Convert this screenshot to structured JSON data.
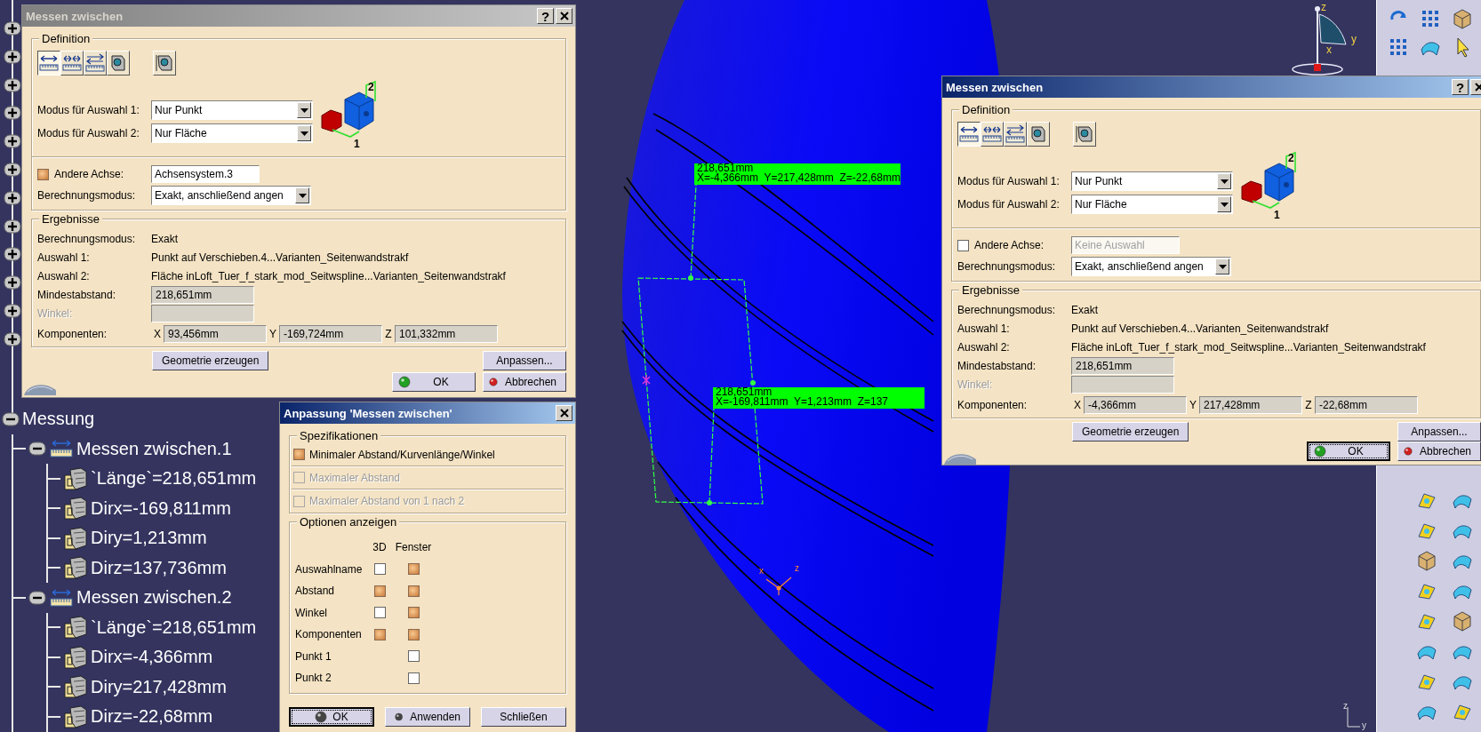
{
  "tree": {
    "hidden_nodes": [
      {
        "expanded": false
      },
      {
        "expanded": false
      },
      {
        "expanded": false
      },
      {
        "expanded": false
      },
      {
        "expanded": false
      },
      {
        "expanded": false
      },
      {
        "expanded": false
      },
      {
        "expanded": false
      },
      {
        "expanded": false
      },
      {
        "expanded": false
      },
      {
        "expanded": false
      },
      {
        "expanded": false
      }
    ],
    "root": {
      "label": "Messung",
      "expanded": true,
      "children": [
        {
          "label": "Messen zwischen.1",
          "expanded": true,
          "children": [
            {
              "label": "`Länge`=218,651mm"
            },
            {
              "label": "Dirx=-169,811mm"
            },
            {
              "label": "Diry=1,213mm"
            },
            {
              "label": "Dirz=137,736mm"
            }
          ]
        },
        {
          "label": "Messen zwischen.2",
          "expanded": true,
          "children": [
            {
              "label": "`Länge`=218,651mm"
            },
            {
              "label": "Dirx=-4,366mm"
            },
            {
              "label": "Diry=217,428mm"
            },
            {
              "label": "Dirz=-22,68mm"
            }
          ]
        }
      ]
    }
  },
  "dialogs": [
    {
      "title": "Messen zwischen",
      "active": false,
      "help_button": "?",
      "definition": {
        "legend": "Definition",
        "tools": [
          {
            "kind": "point-distance",
            "selected": true
          },
          {
            "kind": "chain",
            "selected": false
          },
          {
            "kind": "fan",
            "selected": false
          },
          {
            "kind": "item",
            "selected": false
          },
          {
            "kind": "thickness",
            "selected": false
          }
        ],
        "modes": [
          {
            "label": "Modus für Auswahl 1:",
            "value": "Nur Punkt"
          },
          {
            "label": "Modus für Auswahl 2:",
            "value": "Nur Fläche"
          }
        ],
        "preview_labels": [
          "2",
          "1"
        ],
        "other_axis": {
          "label": "Andere Achse:",
          "checked": true,
          "disabled": false,
          "value": "Achsensystem.3"
        },
        "calc_mode": {
          "label": "Berechnungsmodus:",
          "value": "Exakt, anschließend angen"
        }
      },
      "results": {
        "legend": "Ergebnisse",
        "rows": [
          {
            "label": "Berechnungsmodus:",
            "value": "Exakt"
          },
          {
            "label": "Auswahl 1:",
            "value": "Punkt auf Verschieben.4...Varianten_Seitenwandstrakf"
          },
          {
            "label": "Auswahl 2:",
            "value": "Fläche inLoft_Tuer_f_stark_mod_Seitwspline...Varianten_Seitenwandstrakf"
          }
        ],
        "min_distance": {
          "label": "Mindestabstand:",
          "value": "218,651mm"
        },
        "angle": {
          "label": "Winkel:",
          "disabled": true
        },
        "components": {
          "label": "Komponenten:",
          "items": [
            {
              "axis": "X",
              "value": "93,456mm"
            },
            {
              "axis": "Y",
              "value": "-169,724mm"
            },
            {
              "axis": "Z",
              "value": "101,332mm"
            }
          ]
        }
      },
      "actions": [
        {
          "kind": "geometry",
          "label": "Geometrie erzeugen"
        },
        {
          "kind": "customize",
          "label": "Anpassen..."
        }
      ],
      "footer": [
        {
          "kind": "ok",
          "label": "OK",
          "color": "#22a022",
          "focused": false
        },
        {
          "kind": "cancel",
          "label": "Abbrechen",
          "color": "#d02020",
          "focused": false
        }
      ]
    },
    {
      "title": "Messen zwischen",
      "active": true,
      "help_button": "?",
      "definition": {
        "legend": "Definition",
        "tools": [
          {
            "kind": "point-distance",
            "selected": true
          },
          {
            "kind": "chain",
            "selected": false
          },
          {
            "kind": "fan",
            "selected": false
          },
          {
            "kind": "item",
            "selected": false
          },
          {
            "kind": "thickness",
            "selected": false
          }
        ],
        "modes": [
          {
            "label": "Modus für Auswahl 1:",
            "value": "Nur Punkt"
          },
          {
            "label": "Modus für Auswahl 2:",
            "value": "Nur Fläche"
          }
        ],
        "preview_labels": [
          "2",
          "1"
        ],
        "other_axis": {
          "label": "Andere Achse:",
          "checked": false,
          "disabled": true,
          "placeholder": "Keine Auswahl"
        },
        "calc_mode": {
          "label": "Berechnungsmodus:",
          "value": "Exakt, anschließend angen"
        }
      },
      "results": {
        "legend": "Ergebnisse",
        "rows": [
          {
            "label": "Berechnungsmodus:",
            "value": "Exakt"
          },
          {
            "label": "Auswahl 1:",
            "value": "Punkt auf Verschieben.4...Varianten_Seitenwandstrakf"
          },
          {
            "label": "Auswahl 2:",
            "value": "Fläche inLoft_Tuer_f_stark_mod_Seitwspline...Varianten_Seitenwandstrakf"
          }
        ],
        "min_distance": {
          "label": "Mindestabstand:",
          "value": "218,651mm"
        },
        "angle": {
          "label": "Winkel:",
          "disabled": true
        },
        "components": {
          "label": "Komponenten:",
          "items": [
            {
              "axis": "X",
              "value": "-4,366mm"
            },
            {
              "axis": "Y",
              "value": "217,428mm"
            },
            {
              "axis": "Z",
              "value": "-22,68mm"
            }
          ]
        }
      },
      "actions": [
        {
          "kind": "geometry",
          "label": "Geometrie erzeugen"
        },
        {
          "kind": "customize",
          "label": "Anpassen..."
        }
      ],
      "footer": [
        {
          "kind": "ok",
          "label": "OK",
          "color": "#22a022",
          "focused": true
        },
        {
          "kind": "cancel",
          "label": "Abbrechen",
          "color": "#d02020",
          "focused": false
        }
      ]
    }
  ],
  "adjust_dialog": {
    "title": "Anpassung 'Messen zwischen'",
    "active": true,
    "specs": {
      "legend": "Spezifikationen",
      "items": [
        {
          "label": "Minimaler Abstand/Kurvenlänge/Winkel",
          "checked": true,
          "disabled": false
        },
        {
          "label": "Maximaler Abstand",
          "checked": false,
          "disabled": true
        },
        {
          "label": "Maximaler Abstand von 1 nach 2",
          "checked": false,
          "disabled": true
        }
      ]
    },
    "options": {
      "legend": "Optionen anzeigen",
      "columns": [
        "3D",
        "Fenster"
      ],
      "rows": [
        {
          "label": "Auswahlname",
          "in_3d": {
            "checked": false
          },
          "in_window": {
            "checked": true
          }
        },
        {
          "label": "Abstand",
          "in_3d": {
            "checked": true
          },
          "in_window": {
            "checked": true
          }
        },
        {
          "label": "Winkel",
          "in_3d": {
            "checked": false
          },
          "in_window": {
            "checked": true
          }
        },
        {
          "label": "Komponenten",
          "in_3d": {
            "checked": true
          },
          "in_window": {
            "checked": true
          }
        },
        {
          "label": "Punkt 1",
          "in_window": {
            "checked": false
          }
        },
        {
          "label": "Punkt 2",
          "in_window": {
            "checked": false
          }
        }
      ]
    },
    "footer": [
      {
        "kind": "ok",
        "label": "OK",
        "color": "#444444",
        "focused": true
      },
      {
        "kind": "apply",
        "label": "Anwenden",
        "color": "#444444",
        "focused": false
      },
      {
        "kind": "close",
        "label": "Schließen",
        "focused": false
      }
    ]
  },
  "viewport": {
    "labels": [
      {
        "distance": "218,651mm",
        "coords": "X=-4,366mm  Y=217,428mm  Z=-22,68mm"
      },
      {
        "distance": "218,651mm",
        "coords": "X=-169,811mm  Y=1,213mm  Z=137"
      }
    ],
    "compass_labels": [
      "z",
      "y",
      "x"
    ],
    "part_axis_labels": [
      "x",
      "z"
    ],
    "corner_axis_labels": [
      "z",
      "y"
    ]
  }
}
